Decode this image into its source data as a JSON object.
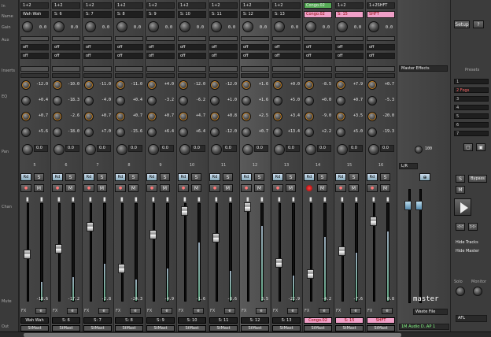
{
  "labels": {
    "in": "In",
    "name": "Name",
    "gain": "Gain",
    "aux": "Aux",
    "inserts": "Inserts",
    "eq": "EQ",
    "pan": "Pan",
    "chan": "Chan",
    "mute": "Mute",
    "out": "Out"
  },
  "channels": [
    {
      "top": "1+2",
      "name": "Wah Wah",
      "gain": "0.0",
      "aux": [
        "off",
        "off"
      ],
      "eq": [
        "-12.0",
        "+0.4",
        "+0.7",
        "+5.6"
      ],
      "pan": "0.0",
      "num": "5",
      "vol": "-18.6",
      "fval": "-18.6",
      "fader": 0.55,
      "meter": 0.18,
      "out": "StMast",
      "nm": "Wah Wah"
    },
    {
      "top": "1+2",
      "name": "S: 6",
      "gain": "0.0",
      "aux": [
        "off",
        "off"
      ],
      "eq": [
        "-10.0",
        "-18.3",
        "-2.6",
        "-18.0"
      ],
      "pan": "0.0",
      "num": "6",
      "vol": "-17.2",
      "fval": "-17.2",
      "fader": 0.5,
      "meter": 0.22,
      "out": "StMast",
      "nm": "S: 6"
    },
    {
      "top": "1+2",
      "name": "S: 7",
      "gain": "0.0",
      "aux": [
        "off",
        "off"
      ],
      "eq": [
        "-11.0",
        "-4.0",
        "+0.7",
        "+7.0"
      ],
      "pan": "0.0",
      "num": "7",
      "vol": "-2.8",
      "fval": "-2.8",
      "fader": 0.3,
      "meter": 0.35,
      "out": "StMast",
      "nm": "S: 7"
    },
    {
      "top": "1+2",
      "name": "S: 8",
      "gain": "0.0",
      "aux": [
        "off",
        "off"
      ],
      "eq": [
        "-11.0",
        "+0.4",
        "+0.7",
        "-15.6"
      ],
      "pan": "0.0",
      "num": "8",
      "vol": "-24.3",
      "fval": "-24.3",
      "fader": 0.68,
      "meter": 0.2,
      "out": "StMast",
      "nm": "S: 8"
    },
    {
      "top": "1+2",
      "name": "S: 9",
      "gain": "0.0",
      "aux": [
        "off",
        "off"
      ],
      "eq": [
        "+4.0",
        "-3.2",
        "+0.7",
        "+6.4"
      ],
      "pan": "0.0",
      "num": "9",
      "vol": "-4.9",
      "fval": "-4.9",
      "fader": 0.37,
      "meter": 0.3,
      "out": "StMast",
      "nm": "S: 9"
    },
    {
      "top": "1+2",
      "name": "S: 10",
      "gain": "0.0",
      "aux": [
        "off",
        "off"
      ],
      "eq": [
        "-12.0",
        "-6.2",
        "+4.7",
        "+6.4"
      ],
      "pan": "0.0",
      "num": "10",
      "vol": "-1.6",
      "fval": "-1.6",
      "fader": 0.16,
      "meter": 0.55,
      "out": "StMast",
      "nm": "S: 10"
    },
    {
      "top": "1+2",
      "name": "S: 11",
      "gain": "0.0",
      "aux": [
        "off",
        "off"
      ],
      "eq": [
        "-12.0",
        "+1.0",
        "+0.8",
        "-12.0"
      ],
      "pan": "0.0",
      "num": "11",
      "vol": "-8.6",
      "fval": "-8.6",
      "fader": 0.4,
      "meter": 0.28,
      "out": "StMast",
      "nm": "S: 11"
    },
    {
      "top": "1+2",
      "name": "S: 12",
      "gain": "0.0",
      "aux": [
        "off",
        "off"
      ],
      "eq": [
        "+1.6",
        "+1.6",
        "+2.5",
        "+0.7"
      ],
      "pan": "0.0",
      "num": "12",
      "vol": "3.5",
      "fval": "3.5",
      "fader": 0.12,
      "meter": 0.7,
      "out": "StMast",
      "nm": "S: 12",
      "sel": true
    },
    {
      "top": "1+2",
      "name": "S: 13",
      "gain": "0.0",
      "aux": [
        "off",
        "off"
      ],
      "eq": [
        "+0.0",
        "+5.0",
        "+3.4",
        "+13.4"
      ],
      "pan": "0.0",
      "num": "13",
      "vol": "-22.9",
      "fval": "-22.9",
      "fader": 0.63,
      "meter": 0.24,
      "out": "StMast",
      "nm": "S: 13"
    },
    {
      "top": "Congo.02",
      "name": "Congo.02",
      "gain": "0.0",
      "aux": [
        "off",
        "off"
      ],
      "eq": [
        "-8.5",
        "+0.0",
        "-9.0",
        "+2.2"
      ],
      "pan": "0.0",
      "num": "14",
      "vol": "-4.2",
      "fval": "-4.2",
      "fader": 0.73,
      "meter": 0.6,
      "out": "StMast",
      "nm": "Congo.02",
      "pink": true,
      "rec": true
    },
    {
      "top": "1+2",
      "name": "S: 15",
      "gain": "0.0",
      "aux": [
        "off",
        "off"
      ],
      "eq": [
        "+7.9",
        "+0.7",
        "+3.5",
        "+5.0"
      ],
      "pan": "0.0",
      "num": "15",
      "vol": "-7.6",
      "fval": "-7.6",
      "fader": 0.52,
      "meter": 0.45,
      "out": "StMast",
      "nm": "S: 15",
      "pink": true
    },
    {
      "top": "1+2SHFT",
      "name": "SHFT",
      "gain": "0.0",
      "aux": [
        "off",
        "off"
      ],
      "eq": [
        "+0.7",
        "-5.3",
        "-20.0",
        "-19.3"
      ],
      "pan": "0.0",
      "num": "16",
      "vol": "0.8",
      "fval": "0.8",
      "fader": 0.25,
      "meter": 0.65,
      "out": "StMast",
      "nm": "SHFT",
      "pink": true
    }
  ],
  "master": {
    "label": "master",
    "fx": "Waste File",
    "out": "1M Audio D..AP 1",
    "eqlbl": "Master Effects",
    "num": "100",
    "lr": "L/R"
  },
  "right": {
    "setup": "Setup",
    "help": "?",
    "presets": "Presets",
    "snapshots": [
      "1",
      "2 Fogs",
      "3",
      "4",
      "5",
      "6",
      "7"
    ],
    "bypass": "Bypass",
    "solo": "Solo",
    "monitor": "Monitor",
    "afl": "AFL",
    "hide_tracks": "Hide Tracks",
    "hide_master": "Hide Master"
  },
  "colors": {
    "accent": "#c8801e",
    "pink": "#f0a0c8"
  }
}
